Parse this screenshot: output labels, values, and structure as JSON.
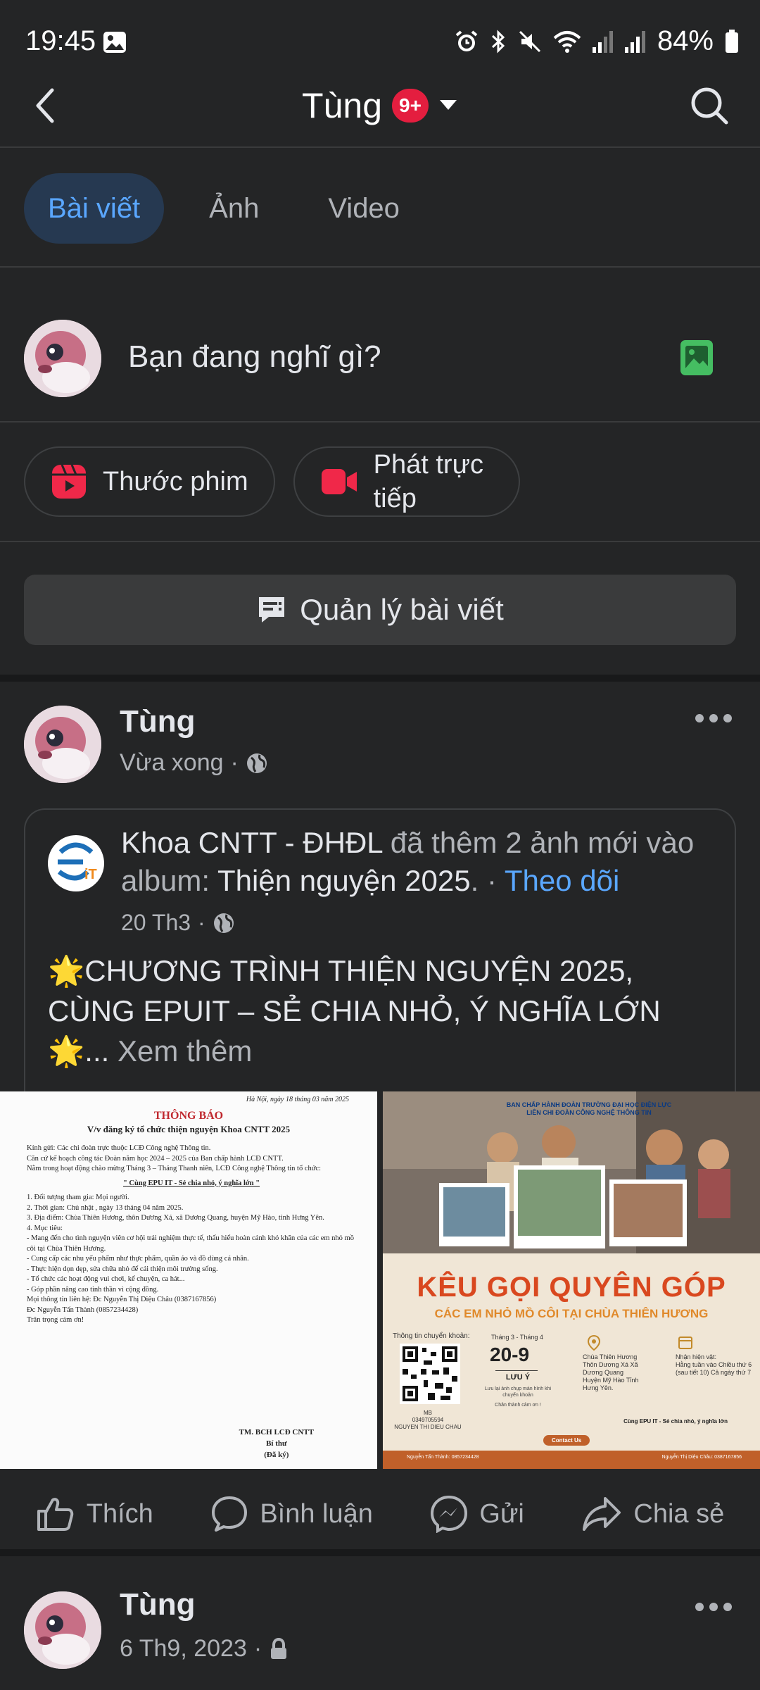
{
  "status_bar": {
    "time": "19:45",
    "battery": "84%",
    "icons": [
      "image-icon",
      "alarm-icon",
      "bluetooth-icon",
      "mute-icon",
      "wifi-icon",
      "signal-icon",
      "signal-icon",
      "battery-icon"
    ]
  },
  "appbar": {
    "title": "Tùng",
    "badge": "9+"
  },
  "tabs": [
    {
      "label": "Bài viết",
      "active": true
    },
    {
      "label": "Ảnh",
      "active": false
    },
    {
      "label": "Video",
      "active": false
    }
  ],
  "composer": {
    "placeholder": "Bạn đang nghĩ gì?"
  },
  "actions": {
    "reels": "Thước phim",
    "live": "Phát trực tiếp"
  },
  "manage_posts": "Quản lý bài viết",
  "post": {
    "author": "Tùng",
    "time": "Vừa xong",
    "separator": "·",
    "shared": {
      "page": "Khoa CNTT - ĐHĐL",
      "action": "đã thêm 2 ảnh mới vào album:",
      "album": "Thiện nguyện 2025",
      "follow": "Theo dõi",
      "date": "20 Th3",
      "body": "🌟CHƯƠNG TRÌNH THIỆN NGUYỆN 2025, CÙNG EPUIT – SẺ CHIA NHỎ, Ý NGHĨA LỚN 🌟...",
      "see_more": "Xem thêm"
    },
    "photo1": {
      "date_line": "Hà Nội, ngày 18 tháng 03 năm 2025",
      "heading": "THÔNG BÁO",
      "subheading": "V/v đăng ký tổ chức thiện nguyện Khoa CNTT 2025",
      "lines": [
        "Kính gửi: Các chi đoàn trực thuộc LCĐ Công nghệ Thông tin.",
        "Căn cứ kế hoạch công tác Đoàn năm học 2024 – 2025 của Ban chấp hành LCĐ CNTT.",
        "Nằm trong hoạt động chào mừng Tháng 3 – Tháng Thanh niên, LCĐ Công nghệ Thông tin tổ chức:",
        "\" Cùng EPU IT - Sẻ chia nhỏ, ý nghĩa lớn \"",
        "1. Đối tượng tham gia: Mọi người.",
        "2. Thời gian: Chủ nhật , ngày 13 tháng 04 năm 2025.",
        "3. Địa điểm: Chùa Thiên Hương, thôn Dương Xá, xã Dương Quang, huyện Mỹ Hào, tỉnh Hưng Yên.",
        "4. Mục tiêu:",
        "- Mang đến cho tình nguyện viên cơ hội trải nghiệm thực tế, thấu hiểu hoàn cảnh khó khăn của các em nhỏ mồ côi tại Chùa Thiên Hương.",
        "- Cung cấp các nhu yếu phẩm như thực phẩm, quần áo và đồ dùng cá nhân.",
        "- Thực hiện dọn dẹp, sửa chữa nhỏ để cải thiện môi trường sống.",
        "- Tổ chức các hoạt động vui chơi, kể chuyện, ca hát...",
        "- Góp phần nâng cao tinh thần vì cộng đồng.",
        "Mọi thông tin liên hệ: Đc Nguyễn Thị Diệu Châu (0387167856)",
        "Đc Nguyễn Tấn Thành (0857234428)",
        "Trân trọng cảm ơn!"
      ],
      "signature_title": "TM. BCH LCĐ CNTT",
      "signature_role": "Bí thư",
      "signature_note": "(Đã ký)"
    },
    "photo2": {
      "header1": "BAN CHẤP HÀNH ĐOÀN TRƯỜNG ĐẠI HỌC ĐIỆN LỰC",
      "header2": "LIÊN CHI ĐOÀN CÔNG NGHỆ THÔNG TIN",
      "title": "KÊU GỌI QUYÊN GÓP",
      "subtitle": "CÁC EM NHỎ MỒ CÔI TẠI CHÙA THIÊN HƯƠNG",
      "transfer_label": "Thông tin chuyển khoản:",
      "months": "Tháng 3 - Tháng 4",
      "date": "20-9",
      "note_label": "LƯU Ý",
      "note": "Lưu lại ảnh chụp màn hình khi chuyển khoản",
      "thanks": "Chân thành cảm ơn !",
      "bank": "MB",
      "account": "0349705594",
      "holder": "NGUYEN THI DIEU CHAU",
      "place": "Chùa Thiên Hương Thôn Dương Xá Xã Dương Quang Huyện Mỹ Hào Tỉnh Hưng Yên.",
      "schedule_label": "Nhận hiện vật:",
      "schedule": "Hằng tuần vào Chiều thứ 6 (sau tiết 10) Cả ngày thứ 7",
      "slogan": "Cùng EPU IT - Sẻ chia nhỏ, ý nghĩa lớn",
      "contact": "Contact Us",
      "contact_left": "Nguyễn Tấn Thành: 0857234428",
      "contact_right": "Nguyễn Thị Diệu Châu: 0387167856"
    },
    "buttons": {
      "like": "Thích",
      "comment": "Bình luận",
      "send": "Gửi",
      "share": "Chia sẻ"
    }
  },
  "post2": {
    "author": "Tùng",
    "time": "6 Th9, 2023",
    "separator": "·"
  },
  "colors": {
    "background": "#242526",
    "accent": "#5aa7ff",
    "badge": "#e41e3f",
    "reels": "#f02849",
    "photo": "#45bd62"
  }
}
